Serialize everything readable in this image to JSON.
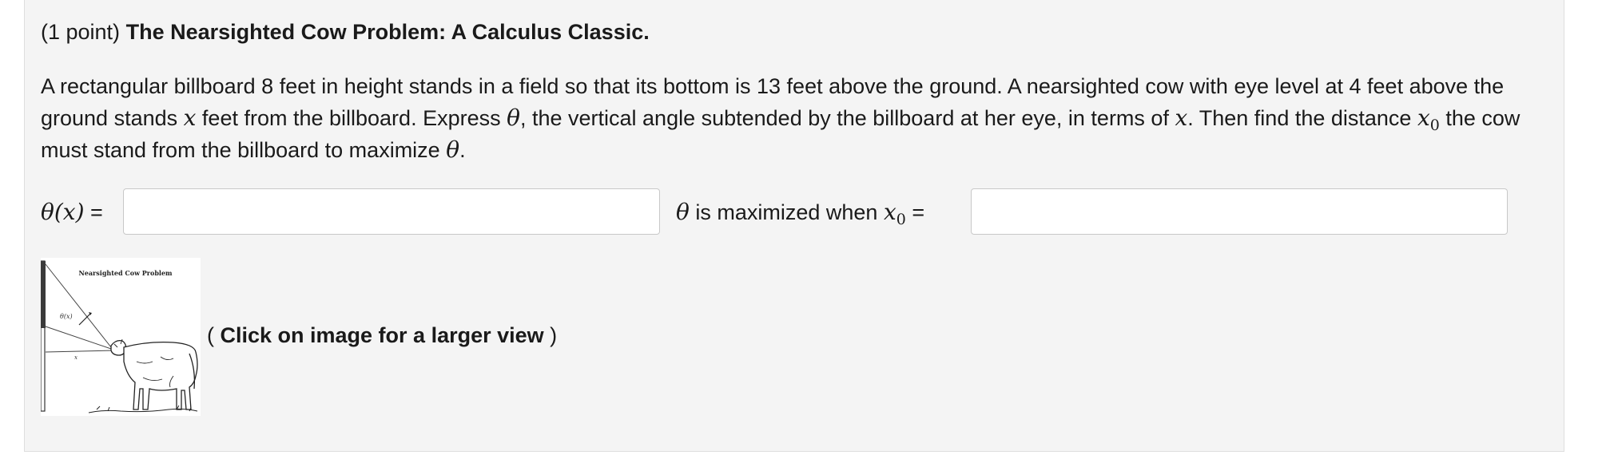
{
  "problem": {
    "points": "(1 point)",
    "title": "The Nearsighted Cow Problem: A Calculus Classic.",
    "statement": {
      "s1": "A rectangular billboard 8 feet in height stands in a field so that its bottom is 13 feet above the ground. A nearsighted cow with eye level at 4 feet above the ground stands ",
      "var_x1": "x",
      "s2": " feet from the billboard. Express ",
      "var_theta1": "θ",
      "s3": ", the vertical angle subtended by the billboard at her eye, in terms of ",
      "var_x2": "x",
      "s4": ". Then find the distance ",
      "var_x0_base": "x",
      "var_x0_sub": "0",
      "s5": " the cow must stand from the billboard to maximize ",
      "var_theta2": "θ",
      "s6": "."
    },
    "answers": {
      "theta_label": "θ(x)",
      "theta_eq": " =",
      "theta_value": "",
      "max_theta": "θ",
      "max_text": " is maximized when ",
      "max_x0_base": "x",
      "max_x0_sub": "0",
      "max_eq": " =",
      "x0_value": ""
    },
    "figure": {
      "image_title": "Nearsighted Cow Problem",
      "angle_label": "θ(x)",
      "x_label": "x",
      "caption_open": "( ",
      "caption_bold": "Click on image for a larger view",
      "caption_close": " )"
    }
  }
}
